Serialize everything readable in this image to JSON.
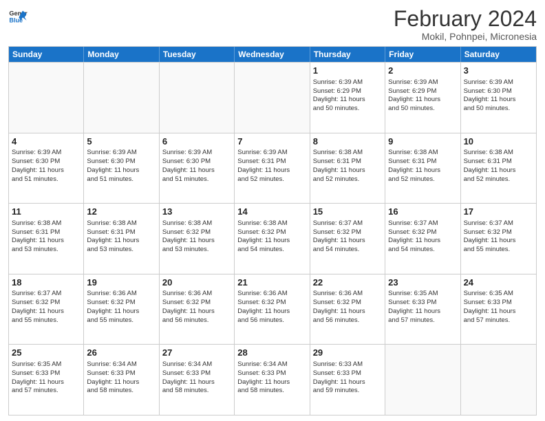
{
  "header": {
    "logo_line1": "General",
    "logo_line2": "Blue",
    "title": "February 2024",
    "subtitle": "Mokil, Pohnpei, Micronesia"
  },
  "days": [
    "Sunday",
    "Monday",
    "Tuesday",
    "Wednesday",
    "Thursday",
    "Friday",
    "Saturday"
  ],
  "weeks": [
    [
      {
        "day": "",
        "content": ""
      },
      {
        "day": "",
        "content": ""
      },
      {
        "day": "",
        "content": ""
      },
      {
        "day": "",
        "content": ""
      },
      {
        "day": "1",
        "content": "Sunrise: 6:39 AM\nSunset: 6:29 PM\nDaylight: 11 hours\nand 50 minutes."
      },
      {
        "day": "2",
        "content": "Sunrise: 6:39 AM\nSunset: 6:29 PM\nDaylight: 11 hours\nand 50 minutes."
      },
      {
        "day": "3",
        "content": "Sunrise: 6:39 AM\nSunset: 6:30 PM\nDaylight: 11 hours\nand 50 minutes."
      }
    ],
    [
      {
        "day": "4",
        "content": "Sunrise: 6:39 AM\nSunset: 6:30 PM\nDaylight: 11 hours\nand 51 minutes."
      },
      {
        "day": "5",
        "content": "Sunrise: 6:39 AM\nSunset: 6:30 PM\nDaylight: 11 hours\nand 51 minutes."
      },
      {
        "day": "6",
        "content": "Sunrise: 6:39 AM\nSunset: 6:30 PM\nDaylight: 11 hours\nand 51 minutes."
      },
      {
        "day": "7",
        "content": "Sunrise: 6:39 AM\nSunset: 6:31 PM\nDaylight: 11 hours\nand 52 minutes."
      },
      {
        "day": "8",
        "content": "Sunrise: 6:38 AM\nSunset: 6:31 PM\nDaylight: 11 hours\nand 52 minutes."
      },
      {
        "day": "9",
        "content": "Sunrise: 6:38 AM\nSunset: 6:31 PM\nDaylight: 11 hours\nand 52 minutes."
      },
      {
        "day": "10",
        "content": "Sunrise: 6:38 AM\nSunset: 6:31 PM\nDaylight: 11 hours\nand 52 minutes."
      }
    ],
    [
      {
        "day": "11",
        "content": "Sunrise: 6:38 AM\nSunset: 6:31 PM\nDaylight: 11 hours\nand 53 minutes."
      },
      {
        "day": "12",
        "content": "Sunrise: 6:38 AM\nSunset: 6:31 PM\nDaylight: 11 hours\nand 53 minutes."
      },
      {
        "day": "13",
        "content": "Sunrise: 6:38 AM\nSunset: 6:32 PM\nDaylight: 11 hours\nand 53 minutes."
      },
      {
        "day": "14",
        "content": "Sunrise: 6:38 AM\nSunset: 6:32 PM\nDaylight: 11 hours\nand 54 minutes."
      },
      {
        "day": "15",
        "content": "Sunrise: 6:37 AM\nSunset: 6:32 PM\nDaylight: 11 hours\nand 54 minutes."
      },
      {
        "day": "16",
        "content": "Sunrise: 6:37 AM\nSunset: 6:32 PM\nDaylight: 11 hours\nand 54 minutes."
      },
      {
        "day": "17",
        "content": "Sunrise: 6:37 AM\nSunset: 6:32 PM\nDaylight: 11 hours\nand 55 minutes."
      }
    ],
    [
      {
        "day": "18",
        "content": "Sunrise: 6:37 AM\nSunset: 6:32 PM\nDaylight: 11 hours\nand 55 minutes."
      },
      {
        "day": "19",
        "content": "Sunrise: 6:36 AM\nSunset: 6:32 PM\nDaylight: 11 hours\nand 55 minutes."
      },
      {
        "day": "20",
        "content": "Sunrise: 6:36 AM\nSunset: 6:32 PM\nDaylight: 11 hours\nand 56 minutes."
      },
      {
        "day": "21",
        "content": "Sunrise: 6:36 AM\nSunset: 6:32 PM\nDaylight: 11 hours\nand 56 minutes."
      },
      {
        "day": "22",
        "content": "Sunrise: 6:36 AM\nSunset: 6:32 PM\nDaylight: 11 hours\nand 56 minutes."
      },
      {
        "day": "23",
        "content": "Sunrise: 6:35 AM\nSunset: 6:33 PM\nDaylight: 11 hours\nand 57 minutes."
      },
      {
        "day": "24",
        "content": "Sunrise: 6:35 AM\nSunset: 6:33 PM\nDaylight: 11 hours\nand 57 minutes."
      }
    ],
    [
      {
        "day": "25",
        "content": "Sunrise: 6:35 AM\nSunset: 6:33 PM\nDaylight: 11 hours\nand 57 minutes."
      },
      {
        "day": "26",
        "content": "Sunrise: 6:34 AM\nSunset: 6:33 PM\nDaylight: 11 hours\nand 58 minutes."
      },
      {
        "day": "27",
        "content": "Sunrise: 6:34 AM\nSunset: 6:33 PM\nDaylight: 11 hours\nand 58 minutes."
      },
      {
        "day": "28",
        "content": "Sunrise: 6:34 AM\nSunset: 6:33 PM\nDaylight: 11 hours\nand 58 minutes."
      },
      {
        "day": "29",
        "content": "Sunrise: 6:33 AM\nSunset: 6:33 PM\nDaylight: 11 hours\nand 59 minutes."
      },
      {
        "day": "",
        "content": ""
      },
      {
        "day": "",
        "content": ""
      }
    ]
  ]
}
